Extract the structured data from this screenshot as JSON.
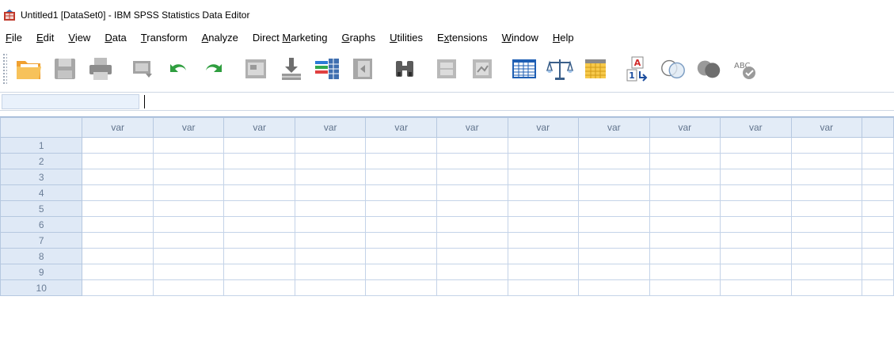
{
  "window": {
    "title": "Untitled1 [DataSet0] - IBM SPSS Statistics Data Editor",
    "app_icon": "spss-data-editor-icon"
  },
  "menu": [
    {
      "label": "File",
      "mnemonic": "F"
    },
    {
      "label": "Edit",
      "mnemonic": "E"
    },
    {
      "label": "View",
      "mnemonic": "V"
    },
    {
      "label": "Data",
      "mnemonic": "D"
    },
    {
      "label": "Transform",
      "mnemonic": "T"
    },
    {
      "label": "Analyze",
      "mnemonic": "A"
    },
    {
      "label": "Direct Marketing",
      "mnemonic": "M"
    },
    {
      "label": "Graphs",
      "mnemonic": "G"
    },
    {
      "label": "Utilities",
      "mnemonic": "U"
    },
    {
      "label": "Extensions",
      "mnemonic": "x"
    },
    {
      "label": "Window",
      "mnemonic": "W"
    },
    {
      "label": "Help",
      "mnemonic": "H"
    }
  ],
  "toolbar": [
    {
      "icon": "open-folder-icon",
      "enabled": true
    },
    {
      "icon": "save-disk-icon",
      "enabled": false
    },
    {
      "icon": "print-icon",
      "enabled": false
    },
    {
      "icon": "dialog-recall-icon",
      "enabled": false
    },
    {
      "icon": "undo-icon",
      "enabled": true
    },
    {
      "icon": "redo-icon",
      "enabled": true
    },
    {
      "icon": "go-to-case-icon",
      "enabled": false
    },
    {
      "icon": "go-to-variable-icon",
      "enabled": true
    },
    {
      "icon": "variables-icon",
      "enabled": true
    },
    {
      "icon": "run-descriptives-icon",
      "enabled": false
    },
    {
      "icon": "find-binoculars-icon",
      "enabled": true
    },
    {
      "icon": "insert-cases-icon",
      "enabled": false
    },
    {
      "icon": "insert-variable-icon",
      "enabled": false
    },
    {
      "icon": "split-file-icon",
      "enabled": true
    },
    {
      "icon": "weight-cases-icon",
      "enabled": true
    },
    {
      "icon": "select-cases-icon",
      "enabled": true
    },
    {
      "icon": "value-labels-icon",
      "enabled": true
    },
    {
      "icon": "use-variable-sets-icon",
      "enabled": true
    },
    {
      "icon": "show-all-variables-icon",
      "enabled": true
    },
    {
      "icon": "spell-check-icon",
      "enabled": true
    }
  ],
  "editor": {
    "cell_reference": "",
    "cell_value": ""
  },
  "grid": {
    "columns": [
      "var",
      "var",
      "var",
      "var",
      "var",
      "var",
      "var",
      "var",
      "var",
      "var",
      "var",
      ""
    ],
    "rows": [
      "1",
      "2",
      "3",
      "4",
      "5",
      "6",
      "7",
      "8",
      "9",
      "10"
    ]
  },
  "colors": {
    "header_bg": "#e3ecf7",
    "row_header_bg": "#dfe9f6",
    "grid_line": "#c4d3e8",
    "header_text": "#60738c"
  }
}
